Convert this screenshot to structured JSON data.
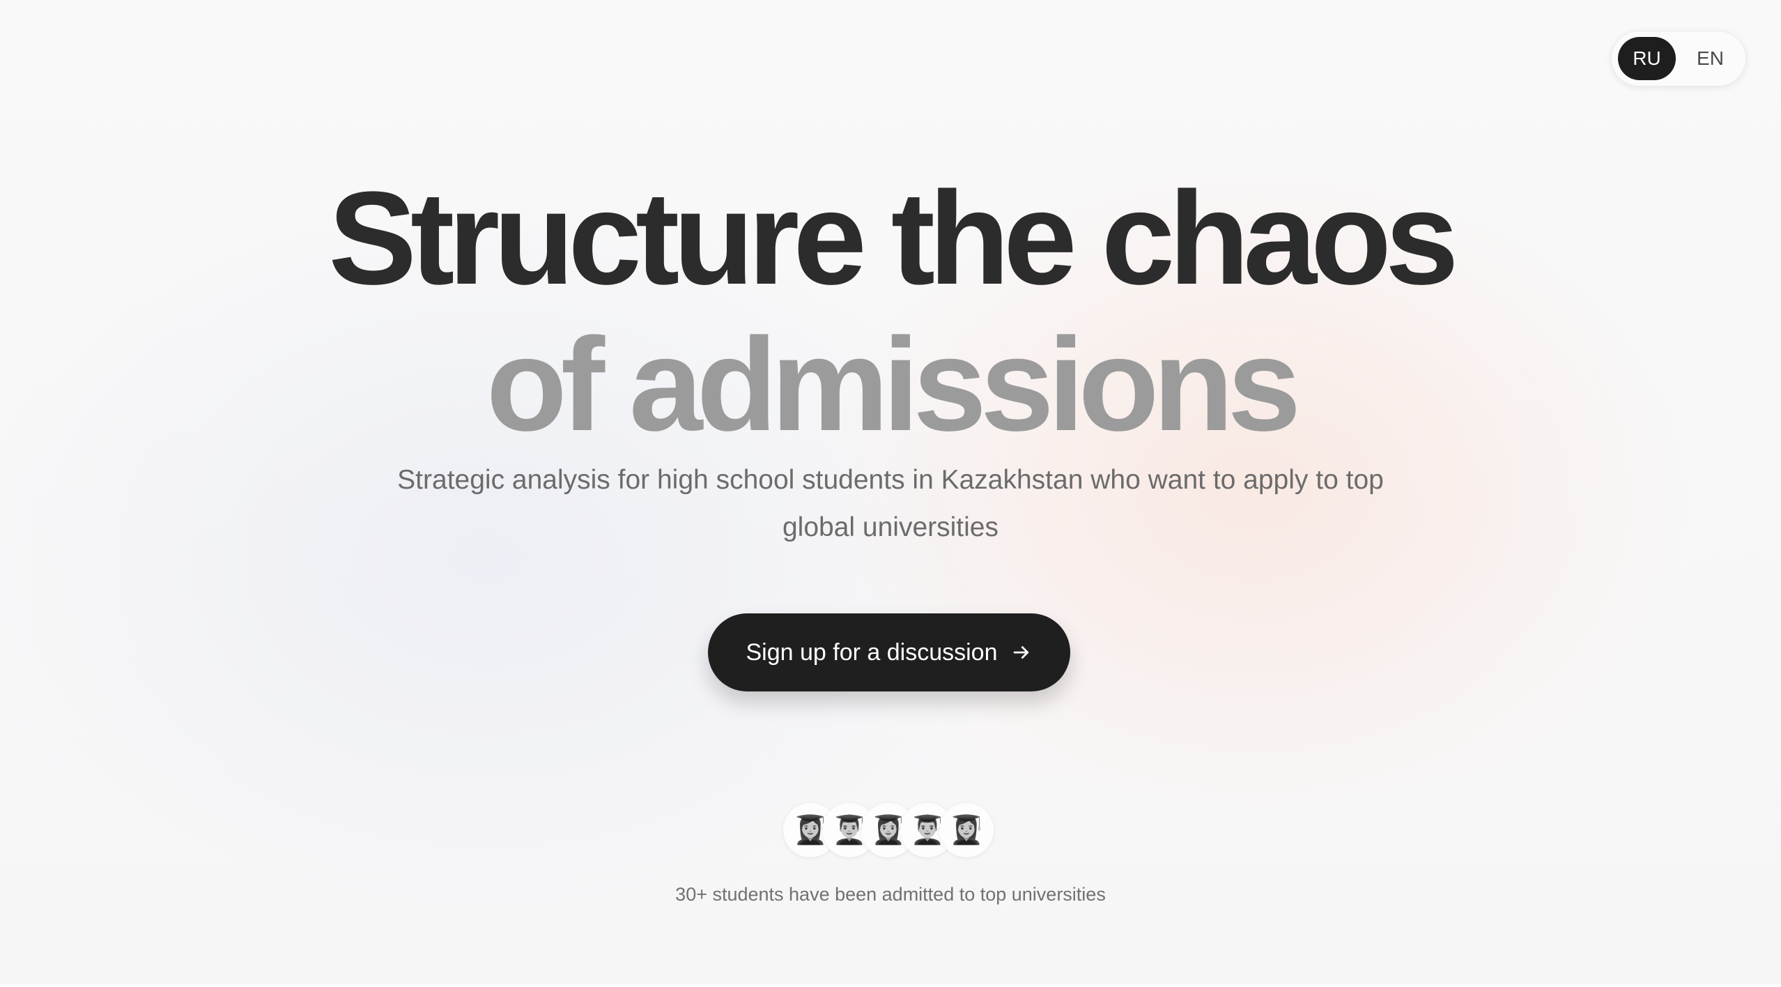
{
  "language_switch": {
    "options": [
      {
        "label": "RU",
        "active": true
      },
      {
        "label": "EN",
        "active": false
      }
    ]
  },
  "hero": {
    "headline_line1": "Structure the chaos",
    "headline_line2": "of admissions",
    "subtitle": "Strategic analysis for high school students in Kazakhstan who want to apply to top global universities",
    "cta_label": "Sign up for a discussion",
    "cta_icon": "arrow-right-icon"
  },
  "social_proof": {
    "avatars": [
      "👩‍🎓",
      "👨‍🎓",
      "👩‍🎓",
      "👨‍🎓",
      "👩‍🎓"
    ],
    "text": "30+ students have been admitted to top universities"
  },
  "colors": {
    "primary_dark": "#1f1f1f",
    "headline_dark": "#2c2c2c",
    "headline_muted": "#9b9b9b",
    "body_text": "#6b6b6b"
  }
}
